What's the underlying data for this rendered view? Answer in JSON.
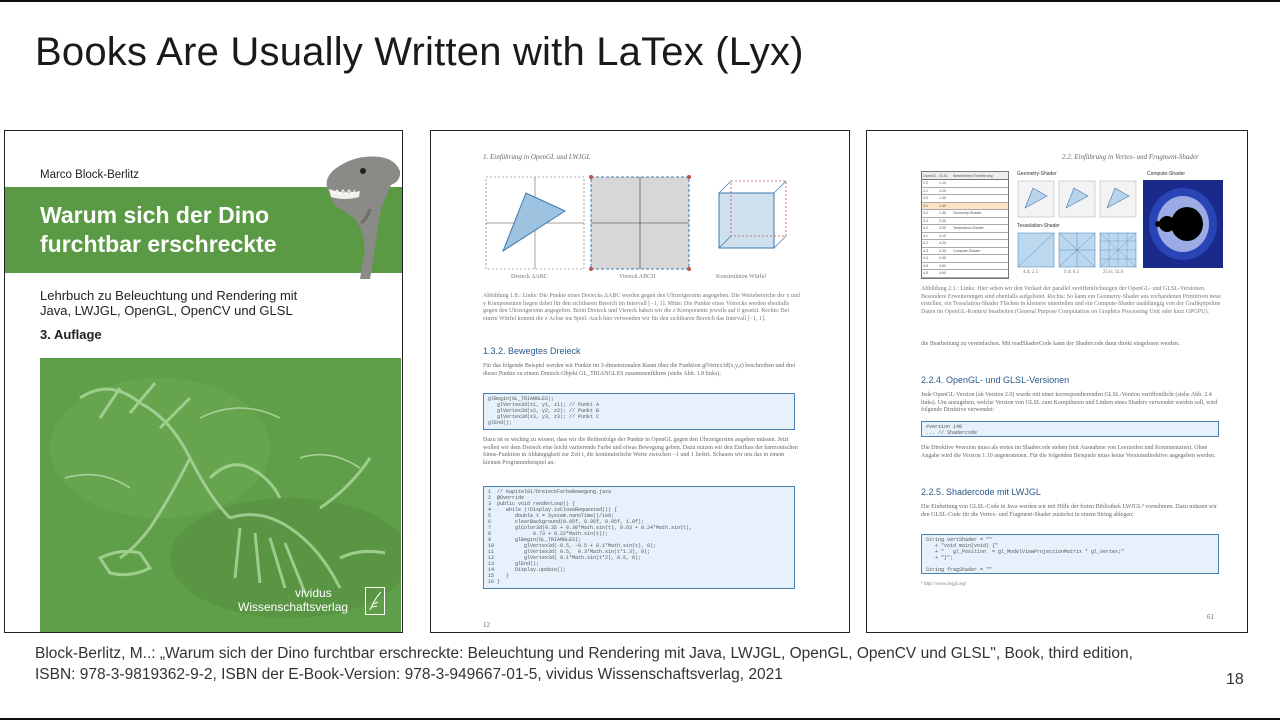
{
  "slide": {
    "title": "Books Are Usually Written with LaTex (Lyx)",
    "caption_line1": "Block-Berlitz, M..: „Warum sich der Dino furchtbar erschreckte: Beleuchtung und Rendering mit Java, LWJGL, OpenGL, OpenCV und GLSL\", Book, third edition,",
    "caption_line2": "ISBN: 978-3-9819362-9-2, ISBN der E-Book-Version: 978-3-949667-01-5, vividus Wissenschaftsverlag, 2021",
    "number": "18"
  },
  "cover": {
    "author": "Marco Block-Berlitz",
    "title_line1": "Warum sich der Dino",
    "title_line2": "furchtbar erschreckte",
    "subtitle_line1": "Lehrbuch zu Beleuchtung und Rendering mit",
    "subtitle_line2": "Java, LWJGL, OpenGL, OpenCV und GLSL",
    "edition": "3. Auflage",
    "publisher_line1": "vividus",
    "publisher_line2": "Wissenschaftsverlag",
    "band_color": "#5b9a45"
  },
  "page_left": {
    "running_head": "1. Einführung in OpenGL und LWJGL",
    "fig_labels": [
      "Dreieck ΔABC",
      "Viereck ABCD",
      "Konstruktion Würfel"
    ],
    "caption": "Abbildung 1.8.: Links: Die Punkte eines Dreiecks ΔABC werden gegen den Uhrzeigersinn angegeben. Die Wertebereiche der x und y Komponenten liegen dabei für den sichtbaren Bereich im Intervall [−1, 1]. Mitte: Die Punkte eines Vierecks werden ebenfalls gegen den Uhrzeigersinn angegeben. Beim Dreieck und Viereck haben wir die z Komponente jeweils auf 0 gesetzt. Rechts: Bei einem Würfel kommt die z Achse ins Spiel. Auch hier verwenden wir für den sichtbaren Bereich das Intervall [−1, 1].",
    "heading": "1.3.2.  Bewegtes Dreieck",
    "para1": "Für das folgende Beispiel werden wir Punkte im 3-dimensionalen Raum über die Funktion glVertex3d(x,y,z) beschreiben und drei dieser Punkte zu einem Dreieck-Objekt GL_TRIANGLES zusammenführen (siehe Abb. 1.8 links):",
    "code1": "glBegin(GL_TRIANGLES);\n   glVertex3d(x1, y1, z1); // Punkt A\n   glVertex3d(x2, y2, z2); // Punkt B\n   glVertex3d(x3, y3, z3); // Punkt C\nglEnd();",
    "para2": "Dazu ist es wichtig zu wissen, dass wir die Reihenfolge der Punkte in OpenGL gegen den Uhrzeigersinn angeben müssen. Jetzt wollen wir dem Dreieck eine leicht variierende Farbe und etwas Bewegung geben. Dazu nutzen wir den Einfluss der harmonischen Sinus-Funktion in Abhängigkeit zur Zeit t, die kontinuierliche Werte zwischen −1 und 1 liefert. Schauen wir uns das in einem kleinen Programmbeispiel an:",
    "code2": "1  // Kapitel01/DreieckFarbeBewegung.java\n2  @Override\n3  public void renderLoop() {\n4     while (!Display.isCloseRequested()) {\n5        double t = System.nanoTime()/1e9;\n6        clearBackground(0.95f, 0.95f, 0.95f, 1.0f);\n7        glColor3d(0.35 + 0.30*Math.sin(t), 0.63 + 0.24*Math.sin(t),\n8              0.73 + 0.22*Math.sin(t));\n9        glBegin(GL_TRIANGLES);\n10          glVertex3d(-0.5, -0.5 + 0.1*Math.sin(t), 0);\n11          glVertex3d( 0.5,  0.3*Math.sin(t*1.3), 0);\n12          glVertex3d( 0.1*Math.sin(t*2), 0.5, 0);\n13       glEnd();\n14       Display.update();\n15    }\n16 }",
    "page_number": "12"
  },
  "page_right": {
    "running_head": "2.2. Einführung in Vertex- und Fragment-Shader",
    "table_headers": [
      "OpenGL",
      "GLSL",
      "Wesentliche Erweiterung"
    ],
    "table_rows": [
      [
        "2.0",
        "1.10",
        ""
      ],
      [
        "2.1",
        "1.20",
        ""
      ],
      [
        "3.0",
        "1.30",
        ""
      ],
      [
        "3.1",
        "1.40",
        ""
      ],
      [
        "3.2",
        "1.50",
        "Geometry-Shader"
      ],
      [
        "3.3",
        "3.30",
        ""
      ],
      [
        "4.0",
        "4.00",
        "Tesselation-Shader"
      ],
      [
        "4.1",
        "4.10",
        ""
      ],
      [
        "4.2",
        "4.20",
        ""
      ],
      [
        "4.3",
        "4.30",
        "Compute-Shader"
      ],
      [
        "4.4",
        "4.40",
        ""
      ],
      [
        "4.5",
        "4.50",
        ""
      ],
      [
        "4.6",
        "4.60",
        ""
      ]
    ],
    "panel_titles": [
      "Geometry-Shader",
      "Tesselation-Shader",
      "Compute-Shader"
    ],
    "tess_labels": [
      "4.4; 2.5",
      "9.4; 8.5",
      "25.6; 32.0"
    ],
    "caption": "Abbildung 2.1.: Links: Hier sehen wir den Verlauf der parallel veröffentlichungen der OpenGL- und GLSL-Versionen. Besondere Erweiterungen sind ebenfalls aufgelistet. Rechts: So kann ein Geometry-Shader aus vorhandenen Primitiven neue erstellen, ein Tesselation-Shader Flächen in kleinere unterteilen und ein Compute-Shader unabhängig von der Grafikpipeline Daten im OpenGL-Kontext bearbeiten (General Purpose Computation on Graphics Processing Unit oder kurz GPGPU).",
    "para0": "die Bearbeitung zu vereinfachen. Mit readShaderCode kann der Shadercode dann direkt eingelesen werden.",
    "heading1": "2.2.4.  OpenGL- und GLSL-Versionen",
    "para1": "Jede OpenGL-Version (ab Version 2.0) wurde mit einer korrespondierenden GLSL-Version veröffentlicht (siehe Abb. 2.4 links). Um anzugeben, welche Version von GLSL zum Kompilieren und Linken eines Shaders verwendet werden soll, wird folgende Direktive verwendet:",
    "code1": "#version 140\n... // Shadercode",
    "para2": "Die Direktive #version muss als erstes im Shadercode stehen (mit Ausnahme von Leerzeilen und Kommentaren). Ohne Angabe wird die Version 1.10 angenommen. Für die folgenden Beispiele muss keine Versionsdirektive angegeben werden.",
    "heading2": "2.2.5.  Shadercode mit LWJGL",
    "para3": "Die Einbettung von GLSL-Code in Java werden wir mit Hilfe der freien Bibliothek LWJGL⁹ vornehmen. Dazu müssen wir den GLSL-Code für die Vertex- und Fragment-Shader zunächst in einem String ablegen:",
    "code2": "String vertShader = \"\"\n   + \"void main(void) {\"\n   + \"   gl_Position  = gl_ModelViewProjectionMatrix * gl_Vertex;\"\n   + \"}\";\n\nString fragShader = \"\"",
    "footnote": "⁹ http://www.lwjgl.org/",
    "page_number": "61"
  }
}
